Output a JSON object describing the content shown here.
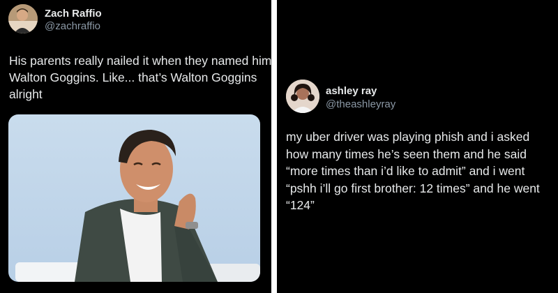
{
  "left_tweet": {
    "display_name": "Zach Raffio",
    "handle": "@zachraffio",
    "text_lines": [
      "His parents really nailed it when they named him",
      "Walton Goggins. Like... that’s Walton Goggins",
      "alright"
    ]
  },
  "right_tweet": {
    "display_name": "ashley ray",
    "handle": "@theashleyray",
    "text_lines": [
      "my uber driver was playing phish and i asked",
      "how many times he’s seen them and he said",
      "“more times than i’d like to admit” and i went",
      "“pshh i’ll go first brother: 12 times” and he went",
      "“124”"
    ]
  },
  "colors": {
    "background": "#000000",
    "text": "#e7e9ea",
    "handle": "#8b98a5",
    "divider": "#ffffff"
  }
}
